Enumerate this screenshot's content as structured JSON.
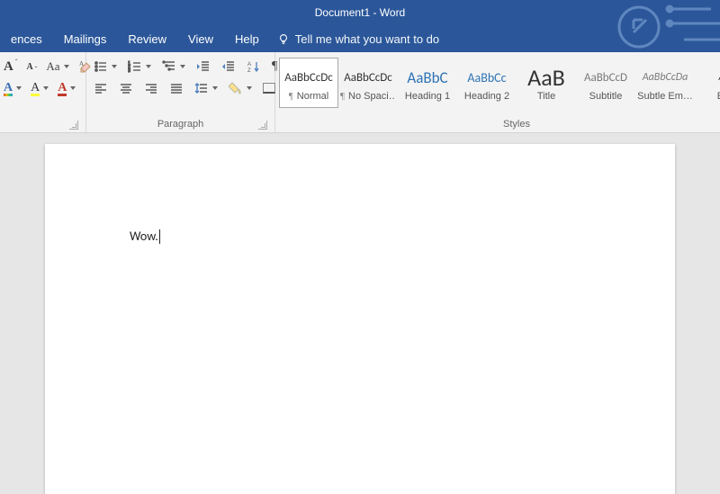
{
  "title": "Document1  -  Word",
  "tabs": {
    "t0": "ences",
    "t1": "Mailings",
    "t2": "Review",
    "t3": "View",
    "t4": "Help"
  },
  "tell_me": "Tell me what you want to do",
  "groups": {
    "font": "",
    "paragraph": "Paragraph",
    "styles": "Styles"
  },
  "font": {
    "grow": "A",
    "shrink": "A",
    "changecase": "Aa",
    "highlight": "A",
    "color": "A",
    "texteffects": "A"
  },
  "para": {
    "sort": "A↓Z",
    "pilcrow": "¶"
  },
  "styles": [
    {
      "name": "Normal",
      "preview": "AaBbCcDc",
      "size": 13,
      "cls": "",
      "pil": true,
      "selected": true
    },
    {
      "name": "No Spaci…",
      "preview": "AaBbCcDc",
      "size": 13,
      "cls": "",
      "pil": true,
      "selected": false
    },
    {
      "name": "Heading 1",
      "preview": "AaBbC",
      "size": 17,
      "cls": "blue",
      "pil": false,
      "selected": false
    },
    {
      "name": "Heading 2",
      "preview": "AaBbCc",
      "size": 14,
      "cls": "blue",
      "pil": false,
      "selected": false
    },
    {
      "name": "Title",
      "preview": "AaB",
      "size": 26,
      "cls": "",
      "pil": false,
      "selected": false
    },
    {
      "name": "Subtitle",
      "preview": "AaBbCcD",
      "size": 13,
      "cls": "gray",
      "pil": false,
      "selected": false
    },
    {
      "name": "Subtle Em…",
      "preview": "AaBbCcDa",
      "size": 12,
      "cls": "gray italic",
      "pil": false,
      "selected": false
    },
    {
      "name": "Em",
      "preview": "Aa",
      "size": 12,
      "cls": "italic",
      "pil": false,
      "selected": false
    }
  ],
  "document": {
    "text": "Wow."
  }
}
